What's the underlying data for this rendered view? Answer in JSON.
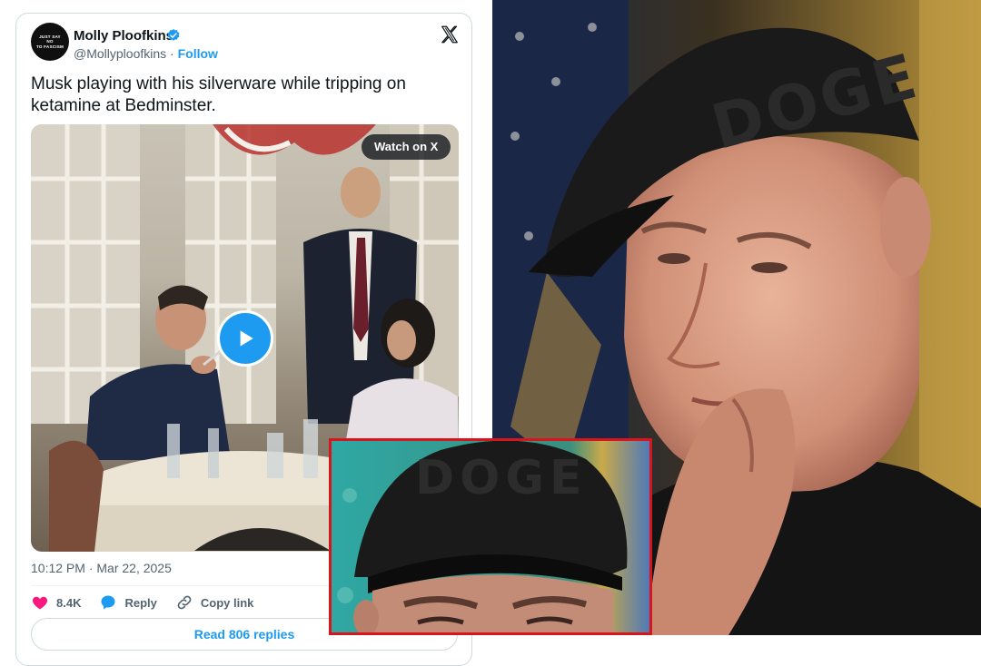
{
  "tweet": {
    "avatar_text": "JUST SAY NO\nTO FASCISM",
    "display_name": "Molly Ploofkins",
    "handle": "@Mollyploofkins",
    "separator": " · ",
    "follow_label": "Follow",
    "text": "Musk playing with his silverware while tripping on ketamine at Bedminster.",
    "media": {
      "watch_label": "Watch on X"
    },
    "timestamp": "10:12 PM · Mar 22, 2025",
    "actions": {
      "likes_count": "8.4K",
      "reply_label": "Reply",
      "copy_link_label": "Copy link"
    },
    "read_replies_label": "Read 806 replies"
  },
  "right_photo": {
    "cap_text": "DOGE"
  },
  "inset_photo": {
    "cap_text": "DOGE",
    "border_color": "#d8141d"
  },
  "colors": {
    "accent": "#1d9bf0",
    "like": "#f91880",
    "text_primary": "#0f1419",
    "text_secondary": "#536471"
  },
  "icons": [
    "verified-badge-icon",
    "x-logo-icon",
    "play-icon",
    "heart-icon",
    "reply-bubble-icon",
    "link-icon"
  ]
}
